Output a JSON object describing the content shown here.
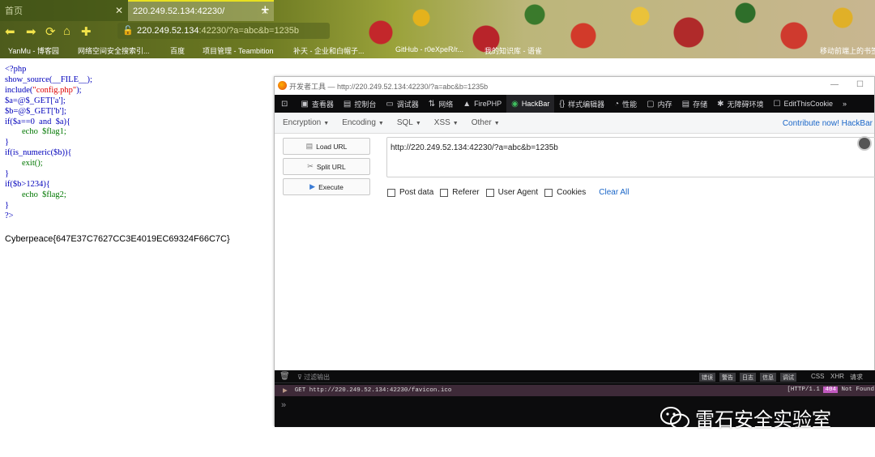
{
  "browser": {
    "tabs": [
      {
        "title": "首页",
        "active": false
      },
      {
        "title": "220.249.52.134:42230/",
        "active": true
      }
    ],
    "url": {
      "host": "220.249.52.134",
      "rest": ":42230/?a=abc&b=1235b"
    },
    "bookmarks": [
      "YanMu - 博客园",
      "网络空间安全搜索引...",
      "百度",
      "项目管理 - Teambition",
      "补天 - 企业和白帽子...",
      "GitHub - r0eXpeR/r...",
      "我的知识库 - 语雀",
      "移动前端上的书签"
    ]
  },
  "page": {
    "source_lines": [
      "<?php",
      "show_source(__FILE__);",
      "include(\"config.php\");",
      "$a=@$_GET['a'];",
      "$b=@$_GET['b'];",
      "if($a==0  and  $a){",
      "        echo  $flag1;",
      "}",
      "if(is_numeric($b)){",
      "        exit();",
      "}",
      "if($b>1234){",
      "        echo  $flag2;",
      "}",
      "?>"
    ],
    "flag_output": "Cyberpeace{647E37C7627CC3E4019EC69324F66C7C}"
  },
  "devtools": {
    "title": "开发者工具 — http://220.249.52.134:42230/?a=abc&b=1235b",
    "tabs": [
      {
        "label": "查看器",
        "icon": "inspector-icon"
      },
      {
        "label": "控制台",
        "icon": "console-icon"
      },
      {
        "label": "调试器",
        "icon": "debugger-icon"
      },
      {
        "label": "网络",
        "icon": "network-icon"
      },
      {
        "label": "FirePHP",
        "icon": "firephp-icon"
      },
      {
        "label": "HackBar",
        "icon": "hackbar-icon"
      },
      {
        "label": "样式编辑器",
        "icon": "style-editor-icon"
      },
      {
        "label": "性能",
        "icon": "performance-icon"
      },
      {
        "label": "内存",
        "icon": "memory-icon"
      },
      {
        "label": "存储",
        "icon": "storage-icon"
      },
      {
        "label": "无障碍环境",
        "icon": "accessibility-icon"
      },
      {
        "label": "EditThisCookie",
        "icon": "cookie-icon"
      }
    ],
    "hackbar": {
      "menus": [
        "Encryption",
        "Encoding",
        "SQL",
        "XSS",
        "Other"
      ],
      "contribute": "Contribute now! HackBar",
      "buttons": {
        "load": "Load URL",
        "split": "Split URL",
        "execute": "Execute"
      },
      "url_value": "http://220.249.52.134:42230/?a=abc&b=1235b",
      "options": [
        "Post data",
        "Referer",
        "User Agent",
        "Cookies"
      ],
      "clear_all": "Clear All"
    },
    "console": {
      "filter_placeholder": "过滤输出",
      "filters": [
        "错误",
        "警告",
        "日志",
        "信息",
        "调试"
      ],
      "filters2": [
        "CSS",
        "XHR",
        "请求"
      ],
      "request": "GET http://220.249.52.134:42230/favicon.ico",
      "http": "[HTTP/1.1",
      "code": "404",
      "status_text": "Not Found",
      "prompt": "»"
    }
  },
  "watermark": {
    "text": "雷石安全实验室"
  }
}
